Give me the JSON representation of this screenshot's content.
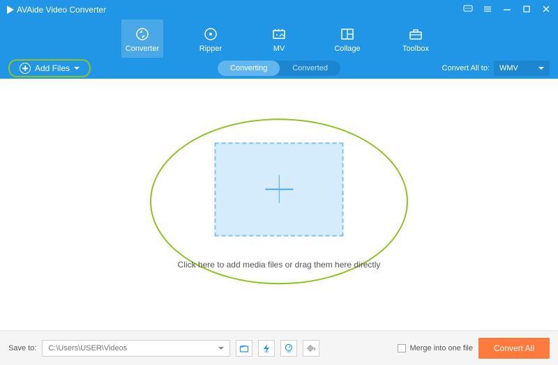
{
  "app": {
    "title": "AVAide Video Converter"
  },
  "nav": [
    {
      "label": "Converter"
    },
    {
      "label": "Ripper"
    },
    {
      "label": "MV"
    },
    {
      "label": "Collage"
    },
    {
      "label": "Toolbox"
    }
  ],
  "toolbar": {
    "add_files": "Add Files",
    "toggle": {
      "converting": "Converting",
      "converted": "Converted"
    },
    "convert_all_to_label": "Convert All to:",
    "format": "WMV"
  },
  "main": {
    "drop_hint": "Click here to add media files or drag them here directly"
  },
  "footer": {
    "save_to_label": "Save to:",
    "save_path": "C:\\Users\\USER\\Videos",
    "merge_label": "Merge into one file",
    "convert_all": "Convert All"
  }
}
